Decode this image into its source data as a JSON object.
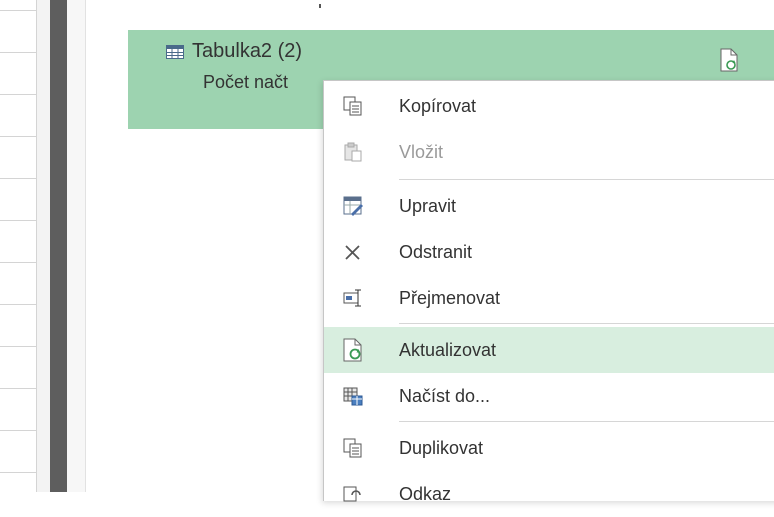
{
  "query": {
    "title": "Tabulka2 (2)",
    "count_text": "Počet načt"
  },
  "colors": {
    "selected_item_bg": "#9dd3b0",
    "menu_hover_bg": "#d8eedf",
    "splitter": "#5e5e5e",
    "refresh_green": "#3a9a54"
  },
  "context_menu": {
    "items": [
      {
        "label": "Kopírovat",
        "icon": "copy-icon",
        "enabled": true
      },
      {
        "label": "Vložit",
        "icon": "paste-icon",
        "enabled": false
      },
      {
        "label": "Upravit",
        "icon": "edit-icon",
        "enabled": true
      },
      {
        "label": "Odstranit",
        "icon": "delete-icon",
        "enabled": true
      },
      {
        "label": "Přejmenovat",
        "icon": "rename-icon",
        "enabled": true
      },
      {
        "label": "Aktualizovat",
        "icon": "refresh-icon",
        "enabled": true,
        "hovered": true
      },
      {
        "label": "Načíst do...",
        "icon": "load-to-icon",
        "enabled": true
      },
      {
        "label": "Duplikovat",
        "icon": "duplicate-icon",
        "enabled": true
      },
      {
        "label": "Odkaz",
        "icon": "reference-icon",
        "enabled": true
      }
    ]
  }
}
